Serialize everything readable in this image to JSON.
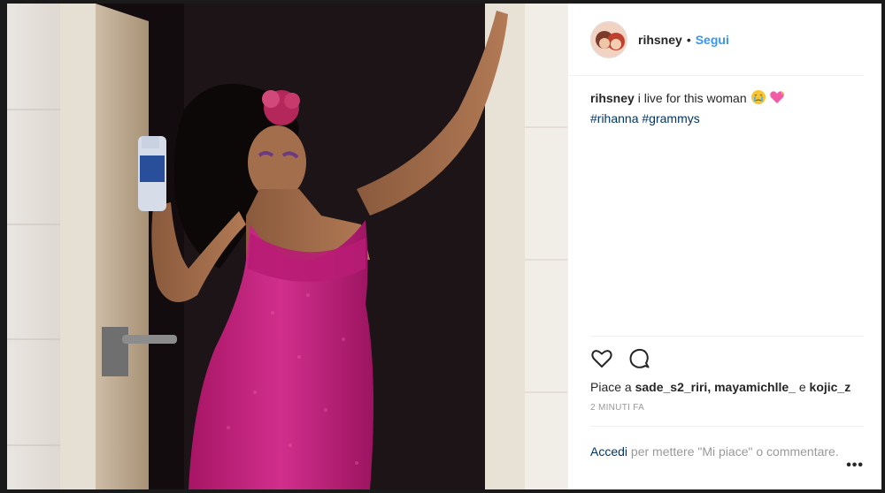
{
  "header": {
    "username": "rihsney",
    "separator": "•",
    "follow_label": "Segui"
  },
  "caption": {
    "author": "rihsney",
    "text": "i live for this woman",
    "hashtag1": "#rihanna",
    "hashtag2": "#grammys"
  },
  "likes": {
    "prefix": "Piace a",
    "user1": "sade_s2_riri",
    "user2": "mayamichlle_",
    "conj": "e",
    "user3": "kojic_z"
  },
  "timestamp": "2 MINUTI FA",
  "footer": {
    "login_label": "Accedi",
    "text": "per mettere \"Mi piace\" o commentare.",
    "more": "•••"
  },
  "colors": {
    "link": "#3897f0",
    "hashtag": "#003569",
    "muted": "#999999",
    "dress": "#c2237e"
  }
}
